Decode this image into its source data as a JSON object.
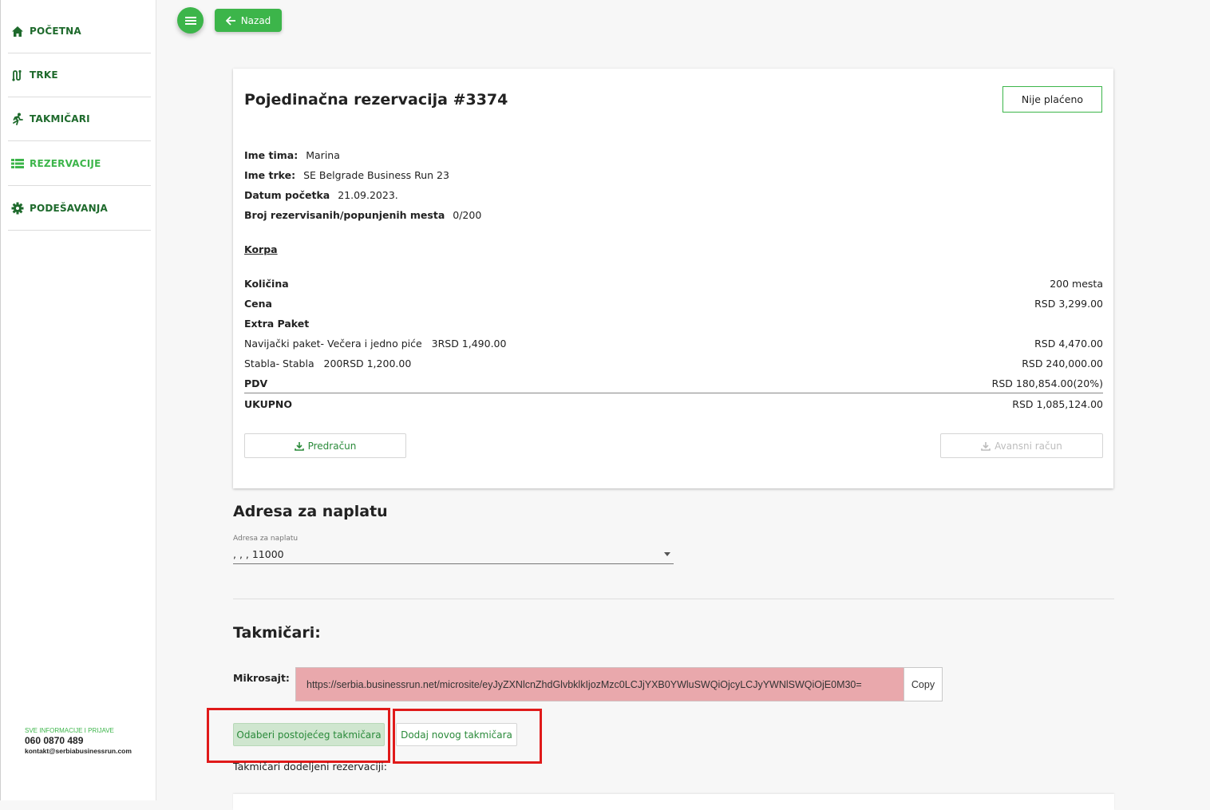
{
  "sidebar": {
    "items": [
      {
        "label": "POČETNA",
        "icon": "home-icon"
      },
      {
        "label": "TRKE",
        "icon": "route-icon"
      },
      {
        "label": "TAKMIČARI",
        "icon": "runner-icon"
      },
      {
        "label": "REZERVACIJE",
        "icon": "list-icon"
      },
      {
        "label": "PODEŠAVANJA",
        "icon": "gear-icon"
      }
    ],
    "footer": {
      "title": "SVE INFORMACIJE I PRIJAVE",
      "phone": "060 0870 489",
      "email": "kontakt@serbiabusinessrun.com"
    }
  },
  "toolbar": {
    "back_label": "Nazad",
    "menu_icon": "hamburger-icon"
  },
  "reservation": {
    "title": "Pojedinačna rezervacija #3374",
    "status_label": "Nije plaćeno",
    "info": [
      {
        "label": "Ime tima:",
        "value": "Marina"
      },
      {
        "label": "Ime trke:",
        "value": "SE Belgrade Business Run 23"
      },
      {
        "label": "Datum početka",
        "value": "21.09.2023."
      },
      {
        "label": "Broj rezervisanih/popunjenih mesta",
        "value": "0/200"
      }
    ],
    "cart_title": "Korpa",
    "cart": [
      {
        "label": "Količina",
        "value": "200 mesta",
        "bold": true
      },
      {
        "label": "Cena",
        "value": "RSD 3,299.00",
        "bold": true
      },
      {
        "label": "Extra Paket",
        "value": "",
        "bold": true
      },
      {
        "label": "Navijački paket- Večera i jedno piće   3RSD 1,490.00",
        "value": "RSD 4,470.00",
        "bold": false
      },
      {
        "label": "Stabla- Stabla   200RSD 1,200.00",
        "value": "RSD 240,000.00",
        "bold": false
      },
      {
        "label": "PDV",
        "value": "RSD 180,854.00(20%)",
        "bold": true
      },
      {
        "label": "UKUPNO",
        "value": "RSD 1,085,124.00",
        "bold": true
      }
    ],
    "proforma_label": "Predračun",
    "advance_label": "Avansni račun"
  },
  "billing": {
    "title": "Adresa za naplatu",
    "field_label": "Adresa za naplatu",
    "selected": ", , , 11000"
  },
  "competitors": {
    "title": "Takmičari:",
    "microsite_label": "Mikrosajt:",
    "microsite_url": "https://serbia.businessrun.net/microsite/eyJyZXNlcnZhdGlvbklkIjozMzc0LCJjYXB0YWluSWQiOjcyLCJyYWNlSWQiOjE0M30=",
    "copy_label": "Copy",
    "existing_label": "Odaberi postojećeg takmičara",
    "new_label": "Dodaj novog takmičara",
    "assigned_label": "Takmičari dodeljeni rezervaciji:"
  },
  "colors": {
    "accent": "#3cb54a",
    "dark_green": "#1e6a2c",
    "highlight": "#e01a1a",
    "url_bg": "#e9a8ac"
  }
}
